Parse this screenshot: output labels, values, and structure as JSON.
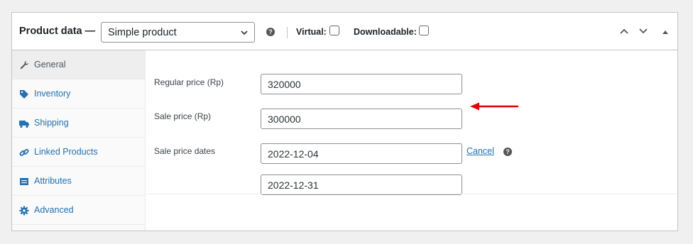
{
  "header": {
    "title": "Product data —",
    "product_type": "Simple product",
    "help_icon": "?",
    "virtual_label": "Virtual:",
    "downloadable_label": "Downloadable:"
  },
  "tabs": [
    {
      "label": "General",
      "icon": "wrench-icon",
      "active": true
    },
    {
      "label": "Inventory",
      "icon": "tag-icon",
      "active": false
    },
    {
      "label": "Shipping",
      "icon": "truck-icon",
      "active": false
    },
    {
      "label": "Linked Products",
      "icon": "link-icon",
      "active": false
    },
    {
      "label": "Attributes",
      "icon": "table-icon",
      "active": false
    },
    {
      "label": "Advanced",
      "icon": "gear-icon",
      "active": false
    }
  ],
  "general": {
    "regular_price_label": "Regular price (Rp)",
    "regular_price": "320000",
    "sale_price_label": "Sale price (Rp)",
    "sale_price": "300000",
    "sale_dates_label": "Sale price dates",
    "sale_date_from": "2022-12-04",
    "sale_date_to": "2022-12-31",
    "cancel_label": "Cancel"
  },
  "colors": {
    "link": "#2271b1",
    "arrow": "#e00000"
  }
}
